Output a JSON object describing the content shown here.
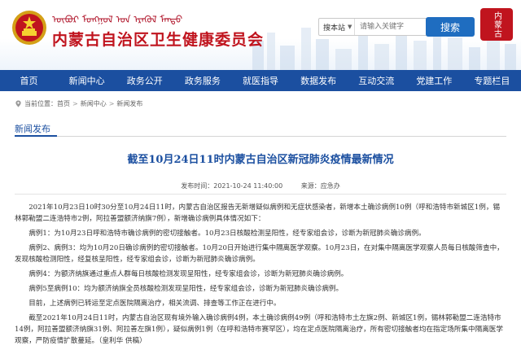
{
  "header": {
    "mongolian_title": "ᠦᠪᠦᠷ ᠮᠤᠩᠭᠤᠯ ᠤᠨ ᠡᠷᠡᠬᠦᠯ ᠮᠡᠨᠳᠦ",
    "site_title": "内蒙古自治区卫生健康委员会",
    "seal_text": "内蒙古",
    "search": {
      "select_label": "搜本站",
      "placeholder": "请输入关键字",
      "button_label": "搜索"
    }
  },
  "nav": {
    "items": [
      "首页",
      "新闻中心",
      "政务公开",
      "政务服务",
      "就医指导",
      "数据发布",
      "互动交流",
      "党建工作",
      "专题栏目"
    ]
  },
  "breadcrumb": {
    "prefix": "当前位置：",
    "items": [
      "首页",
      "新闻中心",
      "新闻发布"
    ]
  },
  "section": {
    "title": "新闻发布"
  },
  "article": {
    "title": "截至10月24日11时内蒙古自治区新冠肺炎疫情最新情况",
    "publish_time": "发布时间：2021-10-24 11:40:00",
    "source": "来源：应急办",
    "paragraphs": [
      "2021年10月23日10时30分至10月24日11时，内蒙古自治区报告无新增疑似病例和无症状感染者，新增本土确诊病例10例（呼和浩特市新城区1例，锡林郭勒盟二连浩特市2例，阿拉善盟额济纳旗7例），新增确诊病例具体情况如下：",
      "病例1：为10月23日呼和浩特市确诊病例的密切接触者。10月23日核酸检测呈阳性，经专家组会诊，诊断为新冠肺炎确诊病例。",
      "病例2、病例3：均为10月20日确诊病例的密切接触者。10月20日开始进行集中隔离医学观察。10月23日，在对集中隔离医学观察人员每日核酸筛查中，发现核酸检测阳性，经复核呈阳性，经专家组会诊，诊断为新冠肺炎确诊病例。",
      "病例4：为额济纳旗通过重点人群每日核酸检测发现呈阳性，经专家组会诊，诊断为新冠肺炎确诊病例。",
      "病例5至病例10：均为额济纳旗全员核酸检测发现呈阳性，经专家组会诊，诊断为新冠肺炎确诊病例。",
      "目前，上述病例已转运至定点医院隔离治疗，相关流调、排查等工作正在进行中。",
      "截至2021年10月24日11时，内蒙古自治区现有境外输入确诊病例4例，本土确诊病例49例（呼和浩特市土左旗2例、新城区1例，锡林郭勒盟二连浩特市14例，阿拉善盟额济纳旗31例、阿拉善左旗1例），疑似病例1例（在呼和浩特市赛罕区），均在定点医院隔离治疗，所有密切接触者均在指定场所集中隔离医学观察，严防疫情扩散蔓延。（皇利华 供稿）"
    ]
  },
  "colors": {
    "brand_red": "#c0141e",
    "nav_blue": "#1b4fa0",
    "search_blue": "#1f6dc0"
  }
}
